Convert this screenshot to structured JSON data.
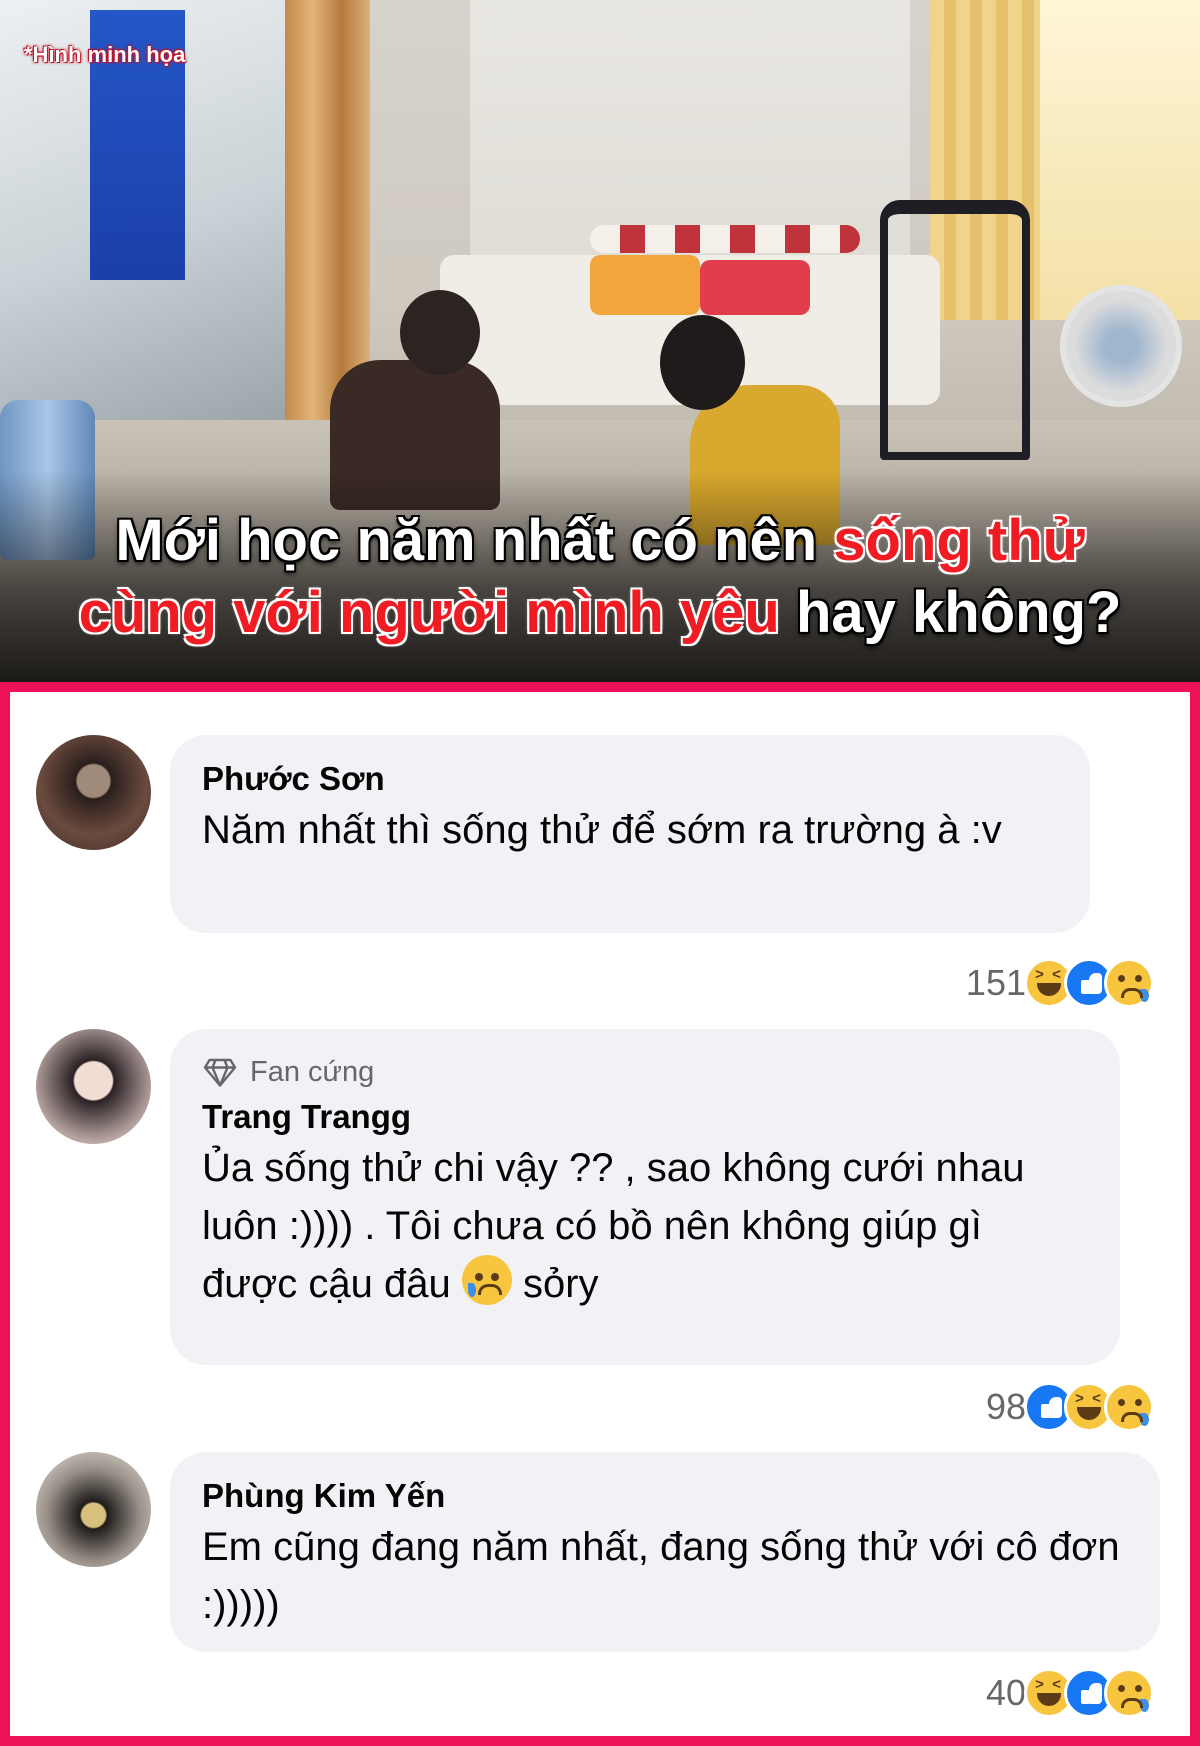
{
  "banner": {
    "tag": "*Hình minh họa",
    "headline_line1_white": "Mới học năm nhất có nên ",
    "headline_line1_red": "sống thử",
    "headline_line2_red": "cùng với người mình yêu",
    "headline_line2_white": " hay không?"
  },
  "comments": [
    {
      "author": "Phước Sơn",
      "text": "Năm nhất thì sống thử để sớm ra trường à :v",
      "reaction_count": "151",
      "reactions": [
        "haha-icon",
        "like-icon",
        "sad-icon"
      ]
    },
    {
      "badge": "Fan cứng",
      "author": "Trang Trangg",
      "text_before_emoji": "Ủa sống thử chi vậy ?? , sao không cưới nhau luôn :)))) . Tôi chưa có bồ nên không giúp gì  được cậu đâu ",
      "text_after_emoji": " sỏry",
      "reaction_count": "98",
      "reactions": [
        "like-icon",
        "haha-icon",
        "sad-icon"
      ]
    },
    {
      "author": "Phùng Kim Yến",
      "text": "Em cũng đang năm nhất, đang sống thử với cô đơn  :)))))",
      "reaction_count": "40",
      "reactions": [
        "haha-icon",
        "like-icon",
        "sad-icon"
      ]
    }
  ],
  "colors": {
    "frame": "#ed1157",
    "headline_red": "#ef1c24",
    "bubble": "#f0f2f5",
    "meta_text": "#65676b",
    "like_blue": "#1877f2",
    "emoji_yellow": "#f7c63e"
  }
}
